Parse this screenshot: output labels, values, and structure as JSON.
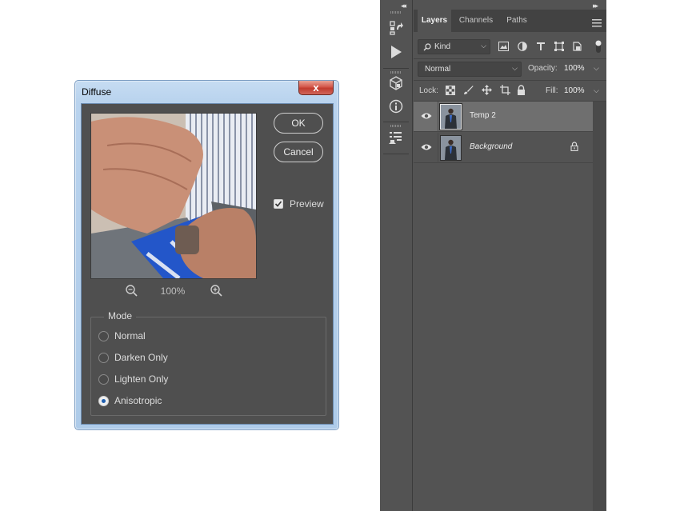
{
  "dialog": {
    "title": "Diffuse",
    "close_symbol": "x",
    "ok_label": "OK",
    "cancel_label": "Cancel",
    "preview_label": "Preview",
    "preview_checked": true,
    "zoom_level": "100%",
    "mode_legend": "Mode",
    "modes": [
      {
        "label": "Normal",
        "selected": false
      },
      {
        "label": "Darken Only",
        "selected": false
      },
      {
        "label": "Lighten Only",
        "selected": false
      },
      {
        "label": "Anisotropic",
        "selected": true
      }
    ]
  },
  "toolstrip": {
    "icons": [
      "history-icon",
      "play-actions-icon",
      "3d-cube-icon",
      "info-icon",
      "properties-icon"
    ]
  },
  "layers_panel": {
    "tabs": [
      {
        "label": "Layers",
        "active": true
      },
      {
        "label": "Channels",
        "active": false
      },
      {
        "label": "Paths",
        "active": false
      }
    ],
    "filter_kind": "Kind",
    "blend_mode": "Normal",
    "opacity_label": "Opacity:",
    "opacity_value": "100%",
    "lock_label": "Lock:",
    "fill_label": "Fill:",
    "fill_value": "100%",
    "layers": [
      {
        "name": "Temp 2",
        "visible": true,
        "selected": true,
        "locked": false
      },
      {
        "name": "Background",
        "visible": true,
        "selected": false,
        "locked": true
      }
    ]
  },
  "colors": {
    "ps_panel": "#535353",
    "dialog_body": "#4f4f4f",
    "selected_layer": "#6f6f6f",
    "radio_accent": "#1f5fb0"
  }
}
